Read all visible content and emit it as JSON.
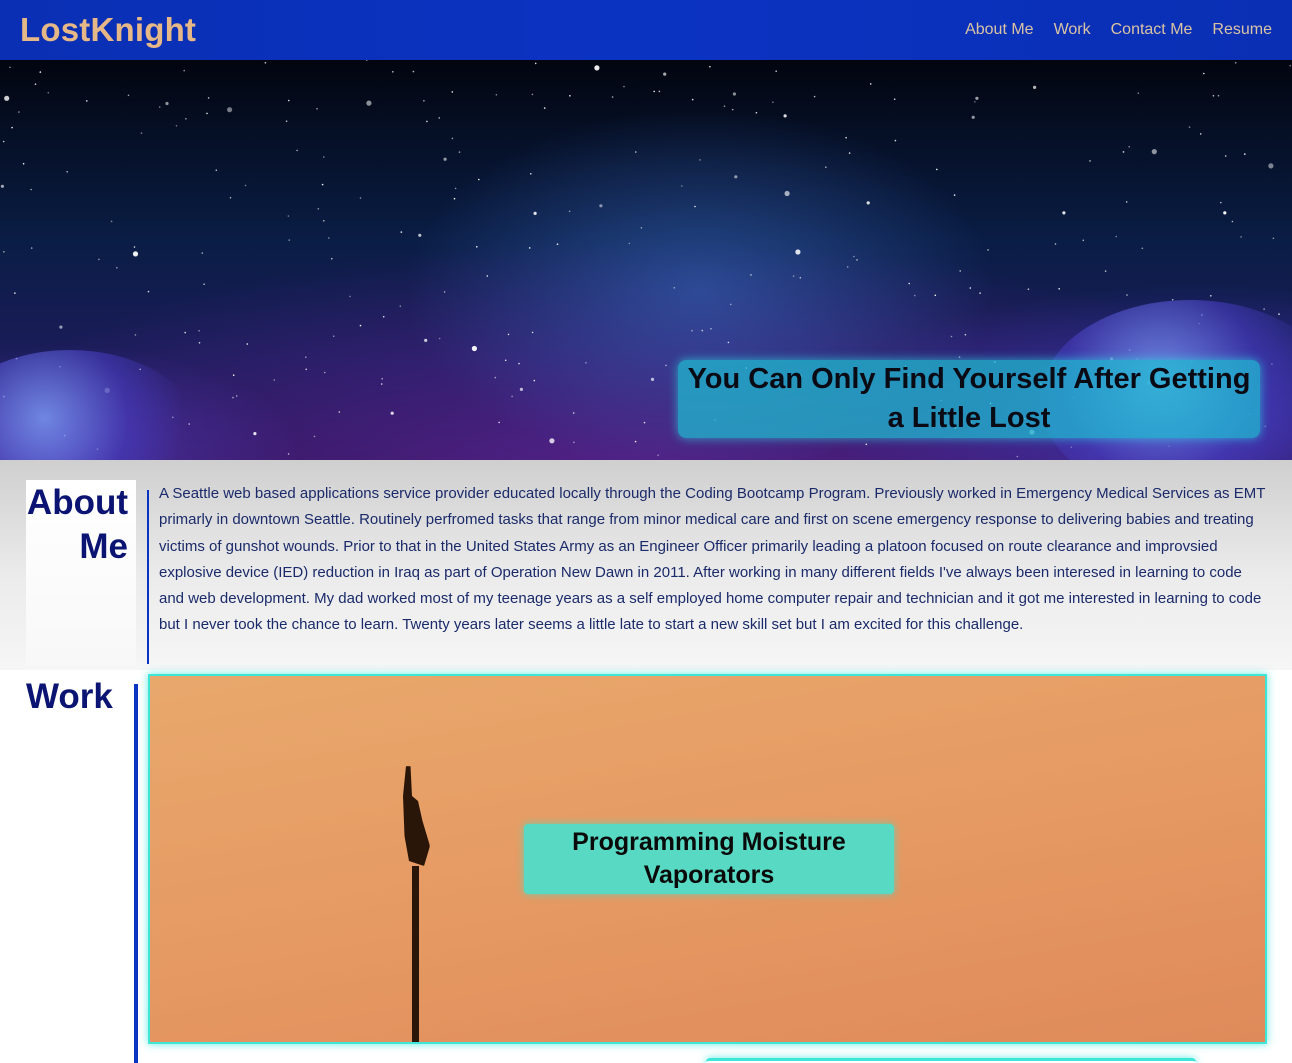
{
  "navbar": {
    "brand": "LostKnight",
    "links": [
      "About Me",
      "Work",
      "Contact Me",
      "Resume"
    ]
  },
  "hero": {
    "tagline": "You Can Only Find Yourself After Getting a Little Lost"
  },
  "about": {
    "title": "About Me",
    "text": "A Seattle web based applications service provider educated locally through the Coding Bootcamp Program. Previously worked in Emergency Medical Services as EMT primarly in downtown Seattle. Routinely perfromed tasks that range from minor medical care and first on scene emergency response to delivering babies and treating victims of gunshot wounds. Prior to that in the United States Army as an Engineer Officer primarily leading a platoon focused on route clearance and improvsied explosive device (IED) reduction in Iraq as part of Operation New Dawn in 2011. After working in many different fields I've always been interesed in learning to code and web development. My dad worked most of my teenage years as a self employed home computer repair and technician and it got me interested in learning to code but I never took the chance to learn. Twenty years later seems a little late to start a new skill set but I am excited for this challenge."
  },
  "work": {
    "title": "Work",
    "projects": [
      {
        "label": "Programming Moisture Vaporators"
      }
    ]
  },
  "colors": {
    "nav_bg": "#0b33c2",
    "brand": "#e7b887",
    "section_title": "#0b1473",
    "accent_cyan": "#3ee6d8"
  }
}
